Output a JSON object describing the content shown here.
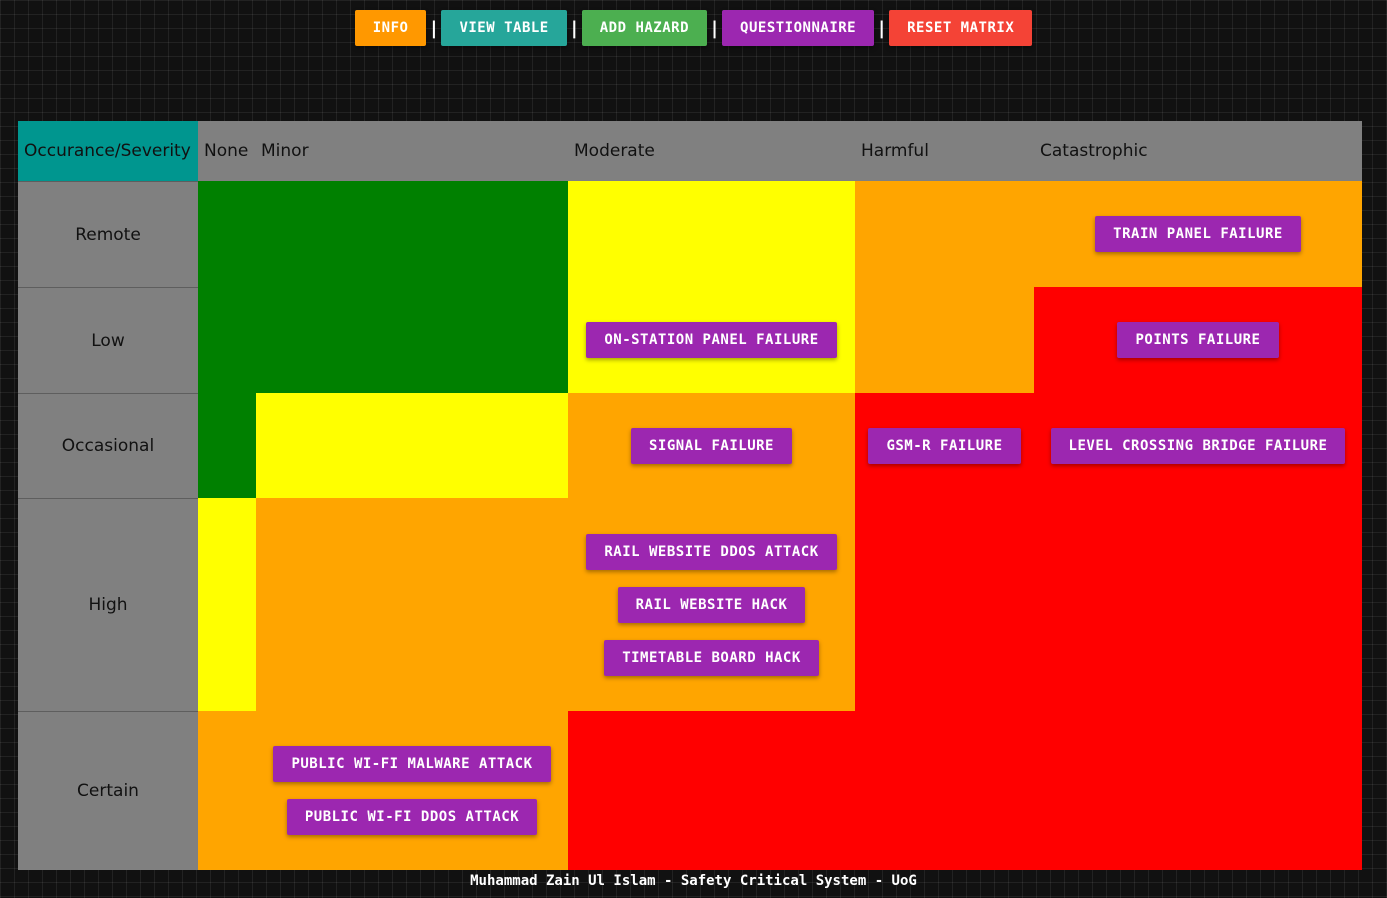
{
  "toolbar": {
    "info": "INFO",
    "view_table": "VIEW TABLE",
    "add_hazard": "ADD HAZARD",
    "questionnaire": "QUESTIONNAIRE",
    "reset_matrix": "RESET MATRIX",
    "separator": "|",
    "colors": {
      "info": "#ff9800",
      "view_table": "#26a69a",
      "add_hazard": "#4caf50",
      "questionnaire": "#9c27b0",
      "reset_matrix": "#f44336"
    }
  },
  "matrix": {
    "corner": "Occurance/Severity",
    "columns": [
      "None",
      "Minor",
      "Moderate",
      "Harmful",
      "Catastrophic"
    ],
    "rows": [
      "Remote",
      "Low",
      "Occasional",
      "High",
      "Certain"
    ],
    "colors": {
      "green": "#008000",
      "yellow": "#ffff00",
      "orange": "#ffa500",
      "red": "#ff0000"
    },
    "hazards": {
      "train_panel_failure": "TRAIN PANEL FAILURE",
      "on_station_panel_failure": "ON-STATION PANEL FAILURE",
      "points_failure": "POINTS FAILURE",
      "signal_failure": "SIGNAL FAILURE",
      "gsm_r_failure": "GSM-R FAILURE",
      "level_crossing_bridge_failure": "LEVEL CROSSING BRIDGE FAILURE",
      "rail_website_ddos_attack": "RAIL WEBSITE DDOS ATTACK",
      "rail_website_hack": "RAIL WEBSITE HACK",
      "timetable_board_hack": "TIMETABLE BOARD HACK",
      "public_wifi_malware_attack": "PUBLIC WI-FI MALWARE ATTACK",
      "public_wifi_ddos_attack": "PUBLIC WI-FI DDOS ATTACK"
    }
  },
  "footer": {
    "text": "Muhammad Zain Ul Islam - Safety Critical System - UoG"
  }
}
